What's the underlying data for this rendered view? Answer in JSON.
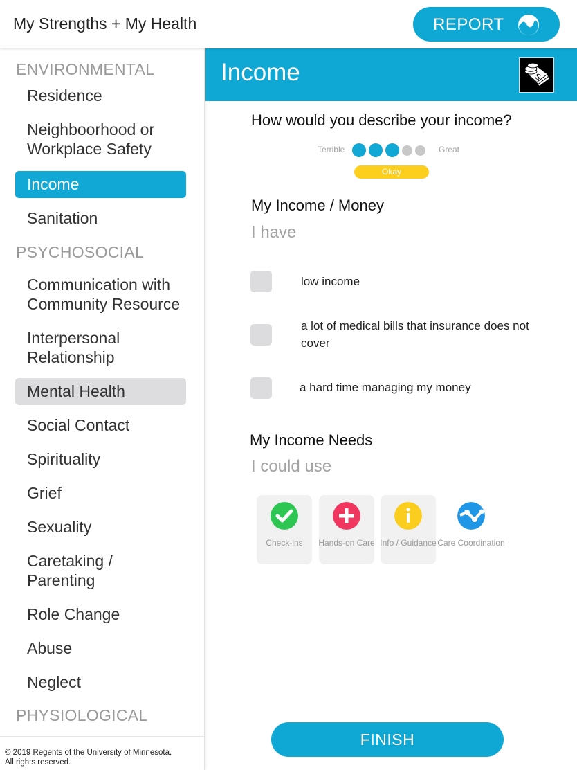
{
  "app": {
    "title": "My Strengths + My Health",
    "report_label": "REPORT",
    "report_icon": "chart-wave-icon"
  },
  "sidebar": {
    "sections": [
      {
        "label": "ENVIRONMENTAL"
      },
      {
        "label": "PSYCHOSOCIAL"
      },
      {
        "label": "PHYSIOLOGICAL"
      }
    ],
    "items": [
      {
        "label": "Residence",
        "section": "ENVIRONMENTAL",
        "state": "normal"
      },
      {
        "label": "Neighboorhood or Workplace Safety",
        "section": "ENVIRONMENTAL",
        "state": "normal"
      },
      {
        "label": "Income",
        "section": "ENVIRONMENTAL",
        "state": "active"
      },
      {
        "label": "Sanitation",
        "section": "ENVIRONMENTAL",
        "state": "normal"
      },
      {
        "label": "Communication with Community Resource",
        "section": "PSYCHOSOCIAL",
        "state": "normal"
      },
      {
        "label": "Interpersonal Relationship",
        "section": "PSYCHOSOCIAL",
        "state": "normal"
      },
      {
        "label": "Mental Health",
        "section": "PSYCHOSOCIAL",
        "state": "highlighted"
      },
      {
        "label": "Social Contact",
        "section": "PSYCHOSOCIAL",
        "state": "normal"
      },
      {
        "label": "Spirituality",
        "section": "PSYCHOSOCIAL",
        "state": "normal"
      },
      {
        "label": "Grief",
        "section": "PSYCHOSOCIAL",
        "state": "normal"
      },
      {
        "label": "Sexuality",
        "section": "PSYCHOSOCIAL",
        "state": "normal"
      },
      {
        "label": "Caretaking / Parenting",
        "section": "PSYCHOSOCIAL",
        "state": "normal"
      },
      {
        "label": "Role Change",
        "section": "PSYCHOSOCIAL",
        "state": "normal"
      },
      {
        "label": "Abuse",
        "section": "PSYCHOSOCIAL",
        "state": "normal"
      },
      {
        "label": "Neglect",
        "section": "PSYCHOSOCIAL",
        "state": "normal"
      }
    ],
    "copyright_line1": "© 2019 Regents of the University of Minnesota.",
    "copyright_line2": "All rights reserved."
  },
  "main": {
    "title": "Income",
    "header_icon": "money-coins-icon",
    "question": "How would you describe your income?",
    "rating": {
      "low_label": "Terrible",
      "high_label": "Great",
      "value": 3,
      "max": 5,
      "value_label": "Okay",
      "colors": {
        "filled": "#12a8d5",
        "empty": "#c8c8c8",
        "pill": "#fccf1f"
      }
    },
    "strengths": {
      "heading": "My Income / Money",
      "prompt": "I have",
      "options": [
        {
          "label": "low income",
          "checked": false
        },
        {
          "label": "a lot of medical bills that insurance does not cover",
          "checked": false
        },
        {
          "label": "a hard time managing my money",
          "checked": false
        }
      ]
    },
    "needs": {
      "heading": "My Income Needs",
      "prompt": "I could use",
      "options": [
        {
          "label": "Check-ins",
          "icon": "check-icon",
          "color": "#2dc653",
          "selected": true
        },
        {
          "label": "Hands-on Care",
          "icon": "plus-icon",
          "color": "#f0365e",
          "selected": true
        },
        {
          "label": "Info / Guidance",
          "icon": "info-icon",
          "color": "#fbcd1f",
          "selected": true
        },
        {
          "label": "Care Coordination",
          "icon": "network-icon",
          "color": "#1f97e6",
          "selected": false
        }
      ]
    },
    "finish_label": "FINISH"
  }
}
